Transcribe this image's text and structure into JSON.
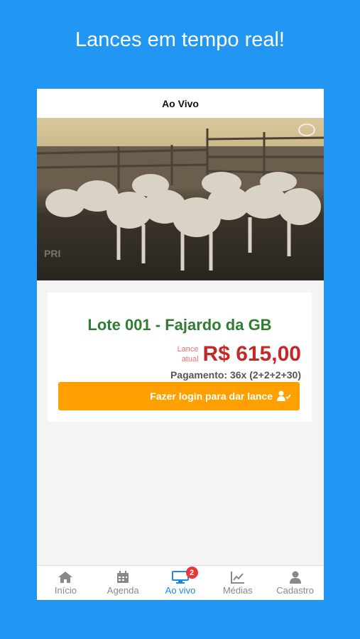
{
  "headline": "Lances em tempo real!",
  "appbar": {
    "title": "Ao Vivo"
  },
  "video": {
    "watermark": "PRI"
  },
  "lot": {
    "title": "Lote 001 - Fajardo da GB",
    "bid_caption_line1": "Lance",
    "bid_caption_line2": "atual",
    "bid_price": "R$ 615,00",
    "payment": "Pagamento: 36x (2+2+2+30)",
    "login_button": "Fazer login para dar lance"
  },
  "tabs": [
    {
      "label": "Início",
      "icon": "home-icon"
    },
    {
      "label": "Agenda",
      "icon": "calendar-icon"
    },
    {
      "label": "Ao vivo",
      "icon": "monitor-icon",
      "badge": "2",
      "active": true
    },
    {
      "label": "Médias",
      "icon": "chart-icon"
    },
    {
      "label": "Cadastro",
      "icon": "user-icon"
    }
  ],
  "colors": {
    "background": "#2196f3",
    "accent": "#1e88e5",
    "lot_title": "#2e7d32",
    "price": "#c62828",
    "button": "#ffa000",
    "badge": "#e53935"
  }
}
